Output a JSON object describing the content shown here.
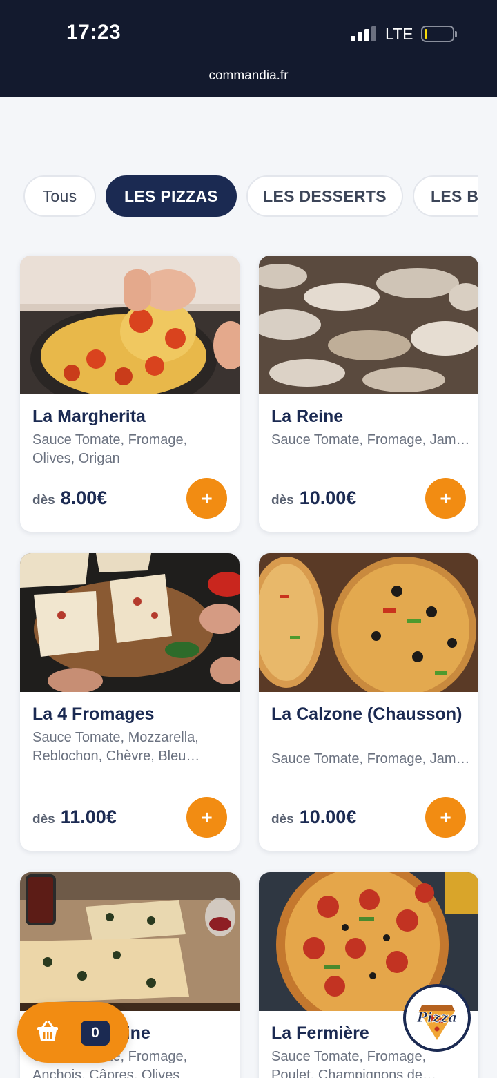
{
  "status": {
    "time": "17:23",
    "network": "LTE"
  },
  "browser": {
    "url": "commandia.fr"
  },
  "tabs": [
    "Tous",
    "LES PIZZAS",
    "LES DESSERTS",
    "LES B"
  ],
  "products": [
    {
      "name": "La Margherita",
      "desc": "Sauce Tomate, Fromage, Olives, Origan",
      "from": "dès",
      "price": "8.00€"
    },
    {
      "name": "La Reine",
      "desc": "Sauce Tomate, Fromage, Jambon, Champignons de…",
      "from": "dès",
      "price": "10.00€"
    },
    {
      "name": "La 4 Fromages",
      "desc": "Sauce Tomate, Mozzarella, Reblochon, Chèvre, Bleu…",
      "from": "dès",
      "price": "11.00€"
    },
    {
      "name": "La Calzone (Chausson)",
      "desc": "Sauce Tomate, Fromage, Jambon, Champignons de…",
      "from": "dès",
      "price": "10.00€"
    },
    {
      "name": "La Napolitaine",
      "desc": "Sauce Tomate, Fromage, Anchois, Câpres, Olives",
      "from": "dès",
      "price": ""
    },
    {
      "name": "La Fermière",
      "desc": "Sauce Tomate, Fromage, Poulet, Champignons de…",
      "from": "dès",
      "price": ""
    }
  ],
  "add_label": "+",
  "cart": {
    "count": "0"
  },
  "logo_text": "Pizza",
  "colors": {
    "navy": "#1b2a52",
    "orange": "#f28c12",
    "statusbar": "#131a2e"
  }
}
